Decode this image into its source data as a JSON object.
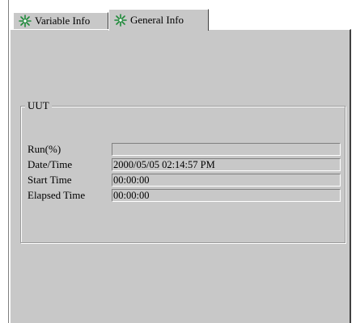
{
  "tabs": [
    {
      "label": "Variable Info",
      "icon": "snowflake-icon",
      "active": false
    },
    {
      "label": "General Info",
      "icon": "snowflake-icon",
      "active": true
    }
  ],
  "group": {
    "title": "UUT",
    "fields": [
      {
        "label": "Run(%)",
        "value": ""
      },
      {
        "label": "Date/Time",
        "value": "2000/05/05 02:14:57 PM"
      },
      {
        "label": "Start Time",
        "value": "00:00:00"
      },
      {
        "label": "Elapsed Time",
        "value": "00:00:00"
      }
    ]
  },
  "colors": {
    "panel": "#c8c8c8",
    "icon": "#1e8a3a"
  }
}
